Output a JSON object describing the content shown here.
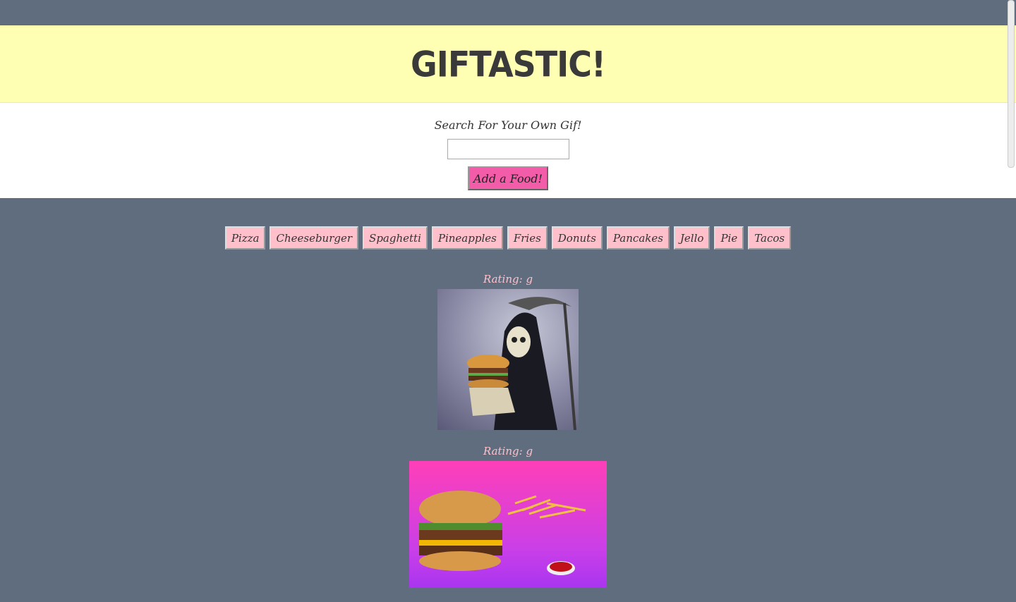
{
  "header": {
    "title": "GIFTASTIC!"
  },
  "form": {
    "label": "Search For Your Own Gif!",
    "input_value": "",
    "button_label": "Add a Food!"
  },
  "foods": [
    "Pizza",
    "Cheeseburger",
    "Spaghetti",
    "Pineapples",
    "Fries",
    "Donuts",
    "Pancakes",
    "Jello",
    "Pie",
    "Tacos"
  ],
  "gifs": [
    {
      "rating": "Rating: g"
    },
    {
      "rating": "Rating: g"
    }
  ],
  "colors": {
    "header_bg": "#ffffb3",
    "page_bg": "#5f6d7e",
    "add_button": "#f25ca9",
    "food_button": "#ffc0cb"
  }
}
